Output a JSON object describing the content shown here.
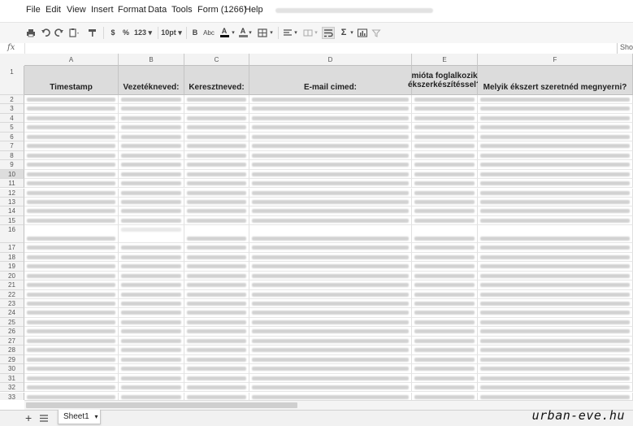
{
  "menubar": {
    "items": [
      "File",
      "Edit",
      "View",
      "Insert",
      "Format",
      "Data",
      "Tools",
      "Form (1266)",
      "Help"
    ]
  },
  "toolbar": {
    "currency": "$",
    "percent": "%",
    "number_format": "123",
    "font_size": "10pt",
    "bold": "B",
    "strikethrough": "Abc",
    "text_color": "A",
    "fill_color": "A"
  },
  "formula_bar": {
    "fx_label": "fx",
    "show_button": "Sho"
  },
  "columns": [
    "A",
    "B",
    "C",
    "D",
    "E",
    "F"
  ],
  "header_row": {
    "row_number": "1",
    "cells": [
      "Timestamp",
      "Vezetékneved:",
      "Keresztneved:",
      "E-mail cimed:",
      "mióta foglalkozik ékszerkészítéssel?",
      "Melyik ékszert szeretnéd megnyerni?"
    ]
  },
  "row_numbers": [
    "2",
    "3",
    "4",
    "5",
    "6",
    "7",
    "8",
    "9",
    "10",
    "11",
    "12",
    "13",
    "14",
    "15",
    "16",
    "17",
    "18",
    "19",
    "20",
    "21",
    "22",
    "23",
    "24",
    "25",
    "26",
    "27",
    "28",
    "29",
    "30",
    "31",
    "32",
    "33"
  ],
  "selected_row": "10",
  "sheet_tab": {
    "label": "Sheet1"
  },
  "watermark": "urban-eve.hu",
  "colors": {
    "header_fill": "#dcdcdc",
    "toolbar_bg": "#f6f6f6",
    "grid_line": "#e0e0e0"
  }
}
